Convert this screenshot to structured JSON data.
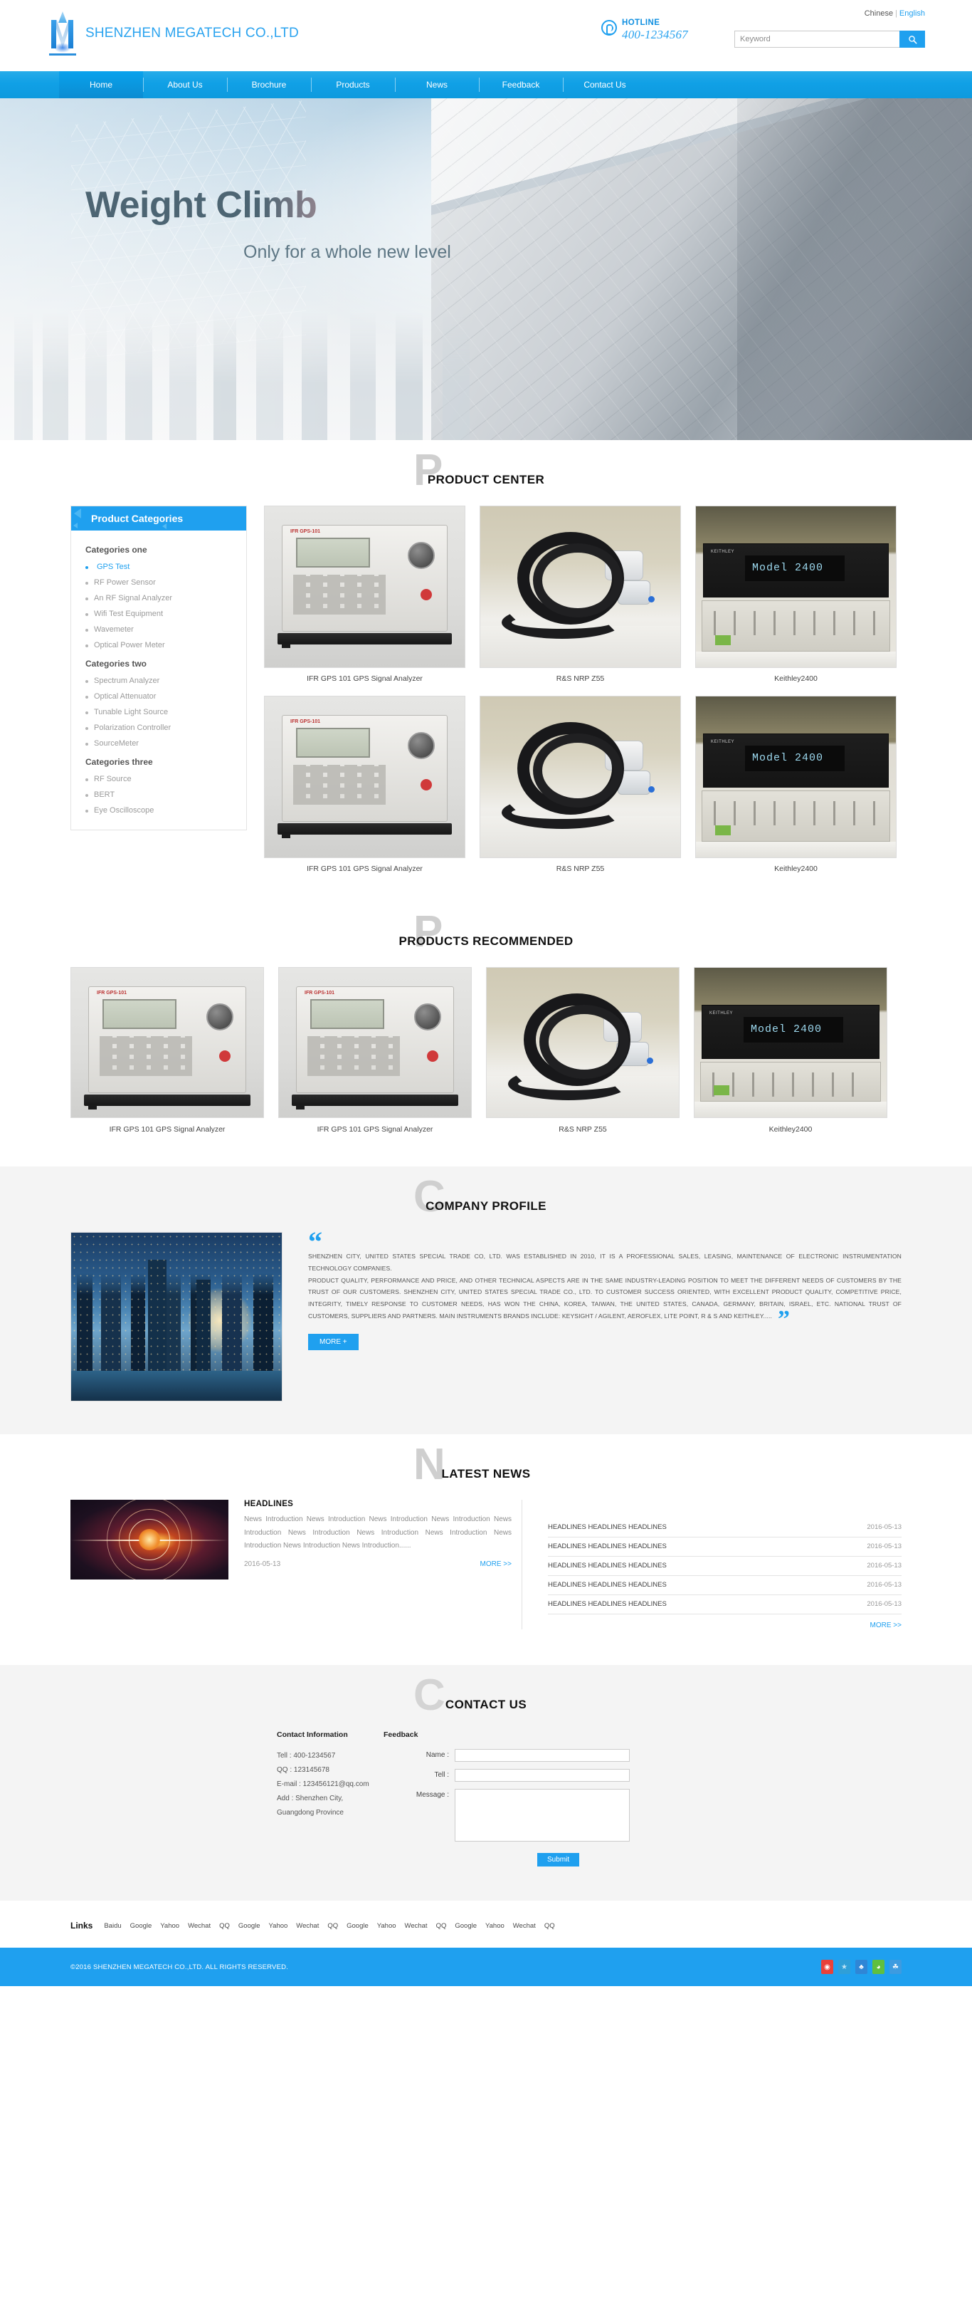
{
  "header": {
    "company_name": "SHENZHEN MEGATECH CO.,LTD",
    "lang_chinese": "Chinese",
    "lang_sep": "|",
    "lang_english": "English",
    "hotline_label": "HOTLINE",
    "hotline_number": "400-1234567",
    "search_placeholder": "Keyword",
    "search_icon": "search-icon"
  },
  "nav": {
    "items": [
      {
        "label": "Home",
        "active": true
      },
      {
        "label": "About Us",
        "active": false
      },
      {
        "label": "Brochure",
        "active": false
      },
      {
        "label": "Products",
        "active": false
      },
      {
        "label": "News",
        "active": false
      },
      {
        "label": "Feedback",
        "active": false
      },
      {
        "label": "Contact Us",
        "active": false
      }
    ]
  },
  "banner": {
    "title": "Weight Climb",
    "subtitle": "Only for a whole new level"
  },
  "product_center": {
    "ghost": "P",
    "title": "PRODUCT CENTER",
    "categories_head": "Product Categories",
    "groups": [
      {
        "title": "Categories one",
        "items": [
          {
            "label": "GPS Test",
            "active": true
          },
          {
            "label": "RF Power Sensor",
            "active": false
          },
          {
            "label": "An RF Signal Analyzer",
            "active": false
          },
          {
            "label": "Wifi Test Equipment",
            "active": false
          },
          {
            "label": "Wavemeter",
            "active": false
          },
          {
            "label": "Optical Power Meter",
            "active": false
          }
        ]
      },
      {
        "title": "Categories two",
        "items": [
          {
            "label": "Spectrum Analyzer",
            "active": false
          },
          {
            "label": "Optical Attenuator",
            "active": false
          },
          {
            "label": "Tunable Light Source",
            "active": false
          },
          {
            "label": "Polarization Controller",
            "active": false
          },
          {
            "label": "SourceMeter",
            "active": false
          }
        ]
      },
      {
        "title": "Categories three",
        "items": [
          {
            "label": "RF Source",
            "active": false
          },
          {
            "label": "BERT",
            "active": false
          },
          {
            "label": "Eye Oscilloscope",
            "active": false
          }
        ]
      }
    ],
    "products": [
      {
        "name": "IFR GPS 101 GPS Signal Analyzer",
        "art": "gps"
      },
      {
        "name": "R&S NRP Z55",
        "art": "cable"
      },
      {
        "name": "Keithley2400",
        "art": "keithley"
      },
      {
        "name": "IFR GPS 101 GPS Signal Analyzer",
        "art": "gps"
      },
      {
        "name": "R&S NRP Z55",
        "art": "cable"
      },
      {
        "name": "Keithley2400",
        "art": "keithley"
      }
    ],
    "keithley_lcd": "Model 2400",
    "gps_brand": "IFR GPS-101"
  },
  "recommended": {
    "ghost": "P",
    "title": "PRODUCTS RECOMMENDED",
    "products": [
      {
        "name": "IFR GPS 101 GPS Signal Analyzer",
        "art": "gps"
      },
      {
        "name": "IFR GPS 101 GPS Signal Analyzer",
        "art": "gps"
      },
      {
        "name": "R&S NRP Z55",
        "art": "cable"
      },
      {
        "name": "Keithley2400",
        "art": "keithley"
      }
    ]
  },
  "company_profile": {
    "ghost": "C",
    "title": "COMPANY PROFILE",
    "quote_open": "“",
    "quote_close": "”",
    "paragraph1": "SHENZHEN CITY, UNITED STATES SPECIAL TRADE CO, LTD. WAS ESTABLISHED IN 2010, IT IS A PROFESSIONAL SALES, LEASING, MAINTENANCE OF ELECTRONIC INSTRUMENTATION TECHNOLOGY COMPANIES.",
    "paragraph2": "PRODUCT QUALITY, PERFORMANCE AND PRICE, AND OTHER TECHNICAL ASPECTS ARE IN THE SAME INDUSTRY-LEADING POSITION TO MEET THE DIFFERENT NEEDS OF CUSTOMERS BY THE TRUST OF OUR CUSTOMERS. SHENZHEN CITY, UNITED STATES SPECIAL TRADE CO., LTD. TO CUSTOMER SUCCESS ORIENTED, WITH EXCELLENT PRODUCT QUALITY, COMPETITIVE PRICE, INTEGRITY, TIMELY RESPONSE TO CUSTOMER NEEDS, HAS WON THE CHINA, KOREA, TAIWAN, THE UNITED STATES, CANADA, GERMANY, BRITAIN, ISRAEL, ETC. NATIONAL TRUST OF CUSTOMERS, SUPPLIERS AND PARTNERS. MAIN INSTRUMENTS BRANDS INCLUDE: KEYSIGHT / AGILENT, AEROFLEX, LITE POINT, R & S AND KEITHLEY.....",
    "more_label": "MORE +"
  },
  "latest_news": {
    "ghost": "N",
    "title": "LATEST NEWS",
    "featured": {
      "headline": "HEADLINES",
      "body": "News Introduction News Introduction News Introduction News Introduction News Introduction News Introduction News Introduction News Introduction News Introduction News Introduction News Introduction......",
      "date": "2016-05-13",
      "more_label": "MORE >>"
    },
    "list": [
      {
        "title": "HEADLINES HEADLINES HEADLINES",
        "date": "2016-05-13"
      },
      {
        "title": "HEADLINES HEADLINES HEADLINES",
        "date": "2016-05-13"
      },
      {
        "title": "HEADLINES HEADLINES HEADLINES",
        "date": "2016-05-13"
      },
      {
        "title": "HEADLINES HEADLINES HEADLINES",
        "date": "2016-05-13"
      },
      {
        "title": "HEADLINES HEADLINES HEADLINES",
        "date": "2016-05-13"
      }
    ],
    "list_more_label": "MORE >>"
  },
  "contact": {
    "ghost": "C",
    "title": "CONTACT US",
    "info_heading": "Contact Information",
    "tel": "Tell : 400-1234567",
    "qq": "QQ : 123145678",
    "email": "E-mail : 123456121@qq.com",
    "address": "Add : Shenzhen City, Guangdong Province",
    "feedback_heading": "Feedback",
    "label_name": "Name :",
    "label_tell": "Tell :",
    "label_message": "Message :",
    "value_name": "",
    "value_tell": "",
    "value_message": "",
    "submit_label": "Submit"
  },
  "links": {
    "title": "Links",
    "items": [
      "Baidu",
      "Google",
      "Yahoo",
      "Wechat",
      "QQ",
      "Google",
      "Yahoo",
      "Wechat",
      "QQ",
      "Google",
      "Yahoo",
      "Wechat",
      "QQ",
      "Google",
      "Yahoo",
      "Wechat",
      "QQ"
    ]
  },
  "footer": {
    "copyright": "©2016 SHENZHEN MEGATECH CO.,LTD. ALL RIGHTS RESERVED.",
    "socials": [
      {
        "name": "weibo-icon",
        "glyph": "◉",
        "cls": "weibo"
      },
      {
        "name": "qzone-icon",
        "glyph": "★",
        "cls": "qzone"
      },
      {
        "name": "tencent-weibo-icon",
        "glyph": "♣",
        "cls": "tweet"
      },
      {
        "name": "wechat-icon",
        "glyph": "◕",
        "cls": "wechat"
      },
      {
        "name": "baidu-icon",
        "glyph": "☘",
        "cls": "baidu"
      }
    ]
  },
  "colors": {
    "accent": "#1fa0ef",
    "nav_gradient_top": "#27ace9",
    "nav_gradient_bottom": "#0e9ade",
    "ghost_gray": "#cfcfcf",
    "panel_gray": "#f4f4f4"
  }
}
